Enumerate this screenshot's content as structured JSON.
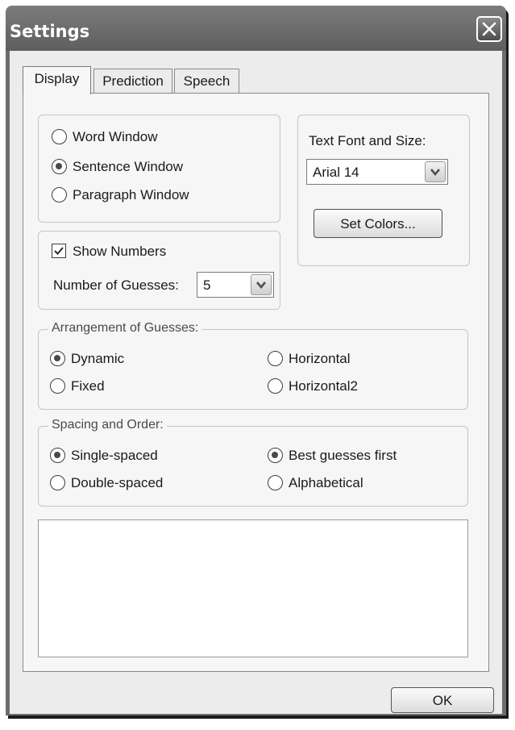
{
  "window": {
    "title": "Settings"
  },
  "tabs": [
    {
      "label": "Display",
      "active": true
    },
    {
      "label": "Prediction",
      "active": false
    },
    {
      "label": "Speech",
      "active": false
    }
  ],
  "window_type": {
    "options": [
      {
        "label": "Word Window",
        "selected": false
      },
      {
        "label": "Sentence Window",
        "selected": true
      },
      {
        "label": "Paragraph Window",
        "selected": false
      }
    ]
  },
  "font": {
    "label": "Text Font and Size:",
    "value": "Arial 14",
    "set_colors_label": "Set Colors..."
  },
  "numbers": {
    "show_numbers_label": "Show Numbers",
    "show_numbers_checked": true,
    "guesses_label": "Number of Guesses:",
    "guesses_value": "5"
  },
  "arrangement": {
    "legend": "Arrangement of Guesses:",
    "options": [
      {
        "label": "Dynamic",
        "selected": true
      },
      {
        "label": "Fixed",
        "selected": false
      },
      {
        "label": "Horizontal",
        "selected": false
      },
      {
        "label": "Horizontal2",
        "selected": false
      }
    ]
  },
  "spacing": {
    "legend": "Spacing and Order:",
    "options": [
      {
        "label": "Single-spaced",
        "selected": true
      },
      {
        "label": "Double-spaced",
        "selected": false
      },
      {
        "label": "Best guesses first",
        "selected": true
      },
      {
        "label": "Alphabetical",
        "selected": false
      }
    ]
  },
  "footer": {
    "ok_label": "OK"
  },
  "icons": {
    "close": "close-icon",
    "dropdown": "chevron-down-icon",
    "check": "checkmark-icon"
  }
}
